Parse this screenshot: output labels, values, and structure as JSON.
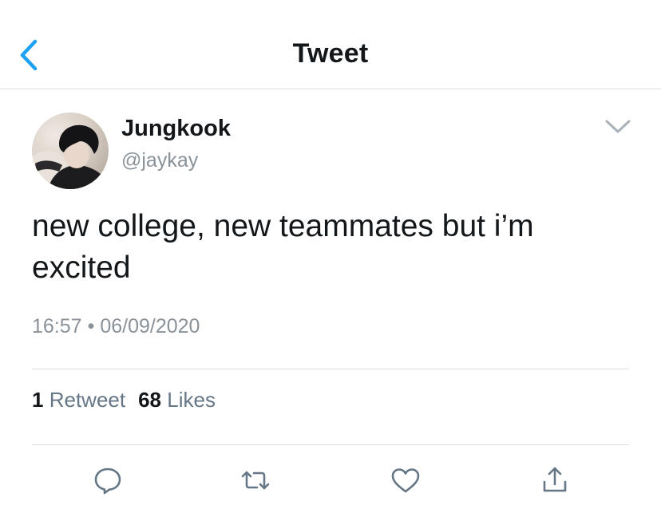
{
  "header": {
    "title": "Tweet"
  },
  "tweet": {
    "author_name": "Jungkook",
    "author_handle": "@jaykay",
    "text": "new college, new teammates but i’m excited",
    "time": "16:57",
    "separator": "•",
    "date": "06/09/2020"
  },
  "stats": {
    "retweets_count": "1",
    "retweets_label": "Retweet",
    "likes_count": "68",
    "likes_label": "Likes"
  },
  "colors": {
    "accent": "#1da1f2",
    "muted_text": "#8a9299",
    "icon_gray": "#657786",
    "divider": "#d9dde1"
  },
  "icons": {
    "back": "chevron-left-icon",
    "more": "chevron-down-icon",
    "reply": "reply-icon",
    "retweet": "retweet-icon",
    "like": "heart-icon",
    "share": "share-icon"
  }
}
